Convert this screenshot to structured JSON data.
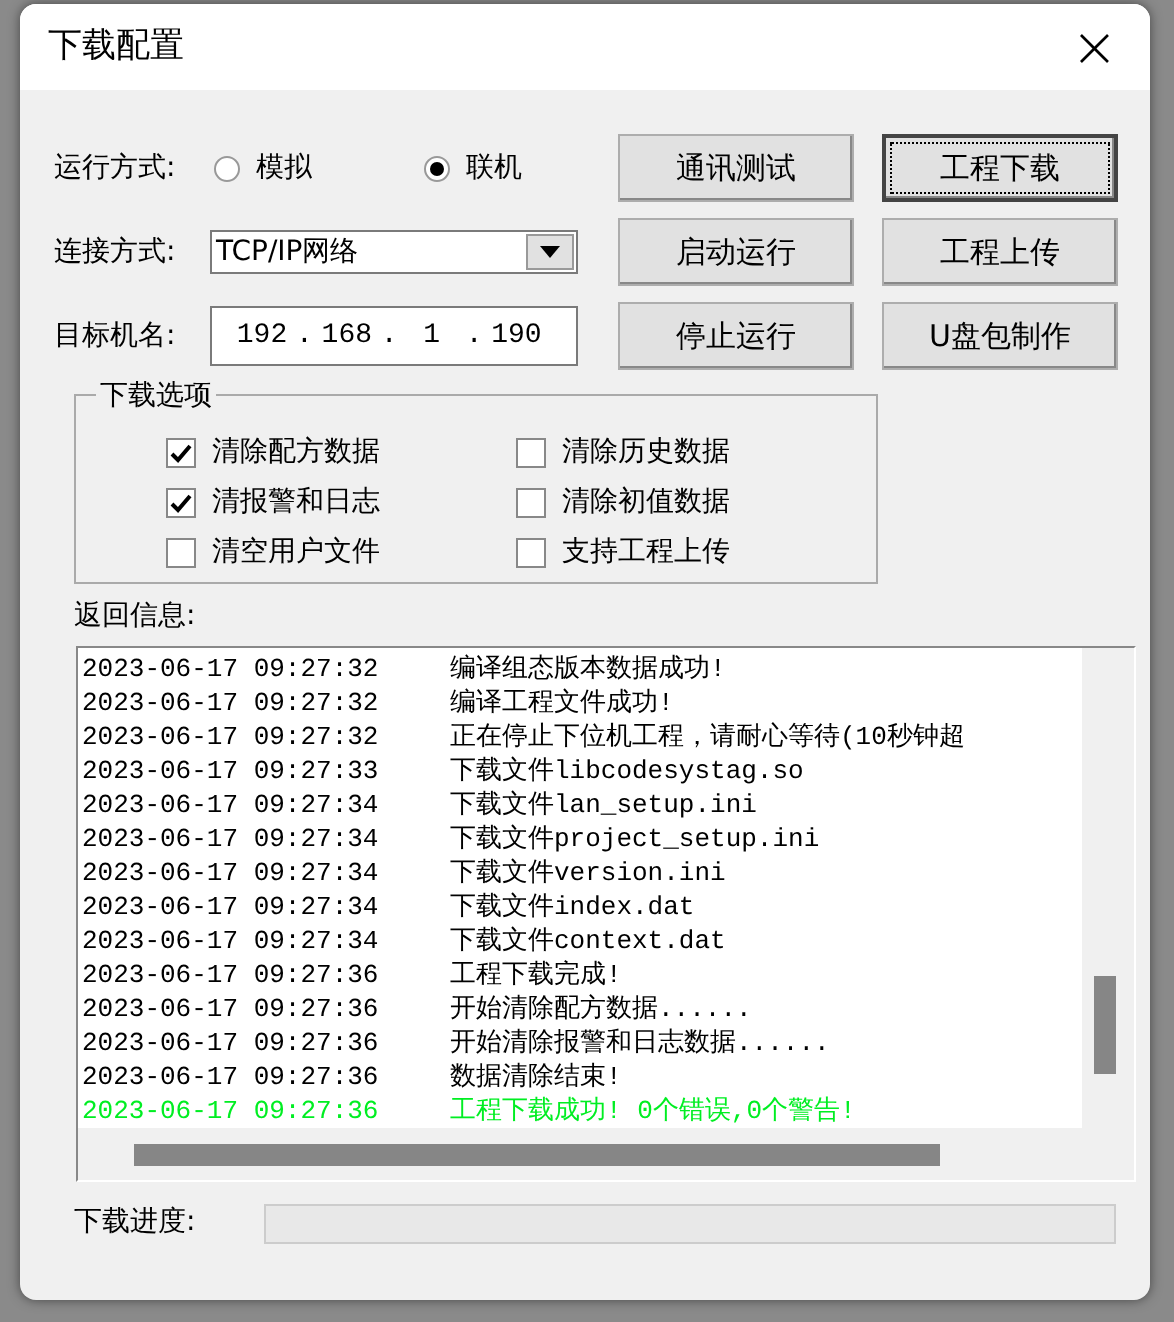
{
  "window": {
    "title": "下载配置",
    "close": "×"
  },
  "run_mode": {
    "label": "运行方式:",
    "options": [
      {
        "label": "模拟",
        "selected": false
      },
      {
        "label": "联机",
        "selected": true
      }
    ]
  },
  "connection": {
    "label": "连接方式:",
    "value": "TCP/IP网络"
  },
  "target": {
    "label": "目标机名:",
    "octets": [
      "192",
      "168",
      "1",
      "190"
    ],
    "separator": "."
  },
  "buttons": [
    {
      "label": "通讯测试",
      "default": false
    },
    {
      "label": "工程下载",
      "default": true
    },
    {
      "label": "启动运行",
      "default": false
    },
    {
      "label": "工程上传",
      "default": false
    },
    {
      "label": "停止运行",
      "default": false
    },
    {
      "label": "U盘包制作",
      "default": false
    }
  ],
  "options_group": {
    "title": "下载选项",
    "items": [
      {
        "label": "清除配方数据",
        "checked": true
      },
      {
        "label": "清除历史数据",
        "checked": false
      },
      {
        "label": "清报警和日志",
        "checked": true
      },
      {
        "label": "清除初值数据",
        "checked": false
      },
      {
        "label": "清空用户文件",
        "checked": false
      },
      {
        "label": "支持工程上传",
        "checked": false
      }
    ]
  },
  "log": {
    "label": "返回信息:",
    "rows": [
      {
        "time": "2023-06-17 09:27:32",
        "message": "编译组态版本数据成功!",
        "kind": "normal"
      },
      {
        "time": "2023-06-17 09:27:32",
        "message": "编译工程文件成功!",
        "kind": "normal"
      },
      {
        "time": "2023-06-17 09:27:32",
        "message": "正在停止下位机工程，请耐心等待(10秒钟超",
        "kind": "normal"
      },
      {
        "time": "2023-06-17 09:27:33",
        "message": "下载文件libcodesystag.so",
        "kind": "normal"
      },
      {
        "time": "2023-06-17 09:27:34",
        "message": "下载文件lan_setup.ini",
        "kind": "normal"
      },
      {
        "time": "2023-06-17 09:27:34",
        "message": "下载文件project_setup.ini",
        "kind": "normal"
      },
      {
        "time": "2023-06-17 09:27:34",
        "message": "下载文件version.ini",
        "kind": "normal"
      },
      {
        "time": "2023-06-17 09:27:34",
        "message": "下载文件index.dat",
        "kind": "normal"
      },
      {
        "time": "2023-06-17 09:27:34",
        "message": "下载文件context.dat",
        "kind": "normal"
      },
      {
        "time": "2023-06-17 09:27:36",
        "message": "工程下载完成!",
        "kind": "normal"
      },
      {
        "time": "2023-06-17 09:27:36",
        "message": "开始清除配方数据......",
        "kind": "normal"
      },
      {
        "time": "2023-06-17 09:27:36",
        "message": "开始清除报警和日志数据......",
        "kind": "normal"
      },
      {
        "time": "2023-06-17 09:27:36",
        "message": "数据清除结束!",
        "kind": "normal"
      },
      {
        "time": "2023-06-17 09:27:36",
        "message": "工程下载成功! 0个错误,0个警告!",
        "kind": "success"
      }
    ]
  },
  "progress": {
    "label": "下载进度:",
    "level": 0
  }
}
